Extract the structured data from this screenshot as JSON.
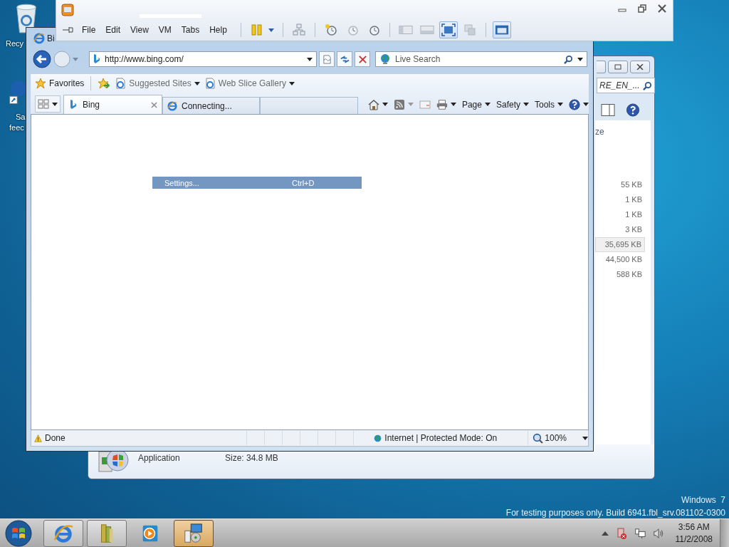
{
  "desktop": {
    "icons": [
      {
        "label": "Recy"
      },
      {
        "label": "Sa"
      },
      {
        "label": "feec"
      }
    ],
    "build_notice": [
      "Windows  7",
      "For testing purposes only. Build 6941.fbl_srv.081102-0300"
    ]
  },
  "explorer_window": {
    "search_value": "RE_EN_...",
    "column_header": "ze",
    "sizes": [
      {
        "text": "55 KB",
        "selected": false
      },
      {
        "text": "1 KB",
        "selected": false
      },
      {
        "text": "1 KB",
        "selected": false
      },
      {
        "text": "3 KB",
        "selected": false
      },
      {
        "text": "35,695 KB",
        "selected": true
      },
      {
        "text": "44,500 KB",
        "selected": false
      },
      {
        "text": "588 KB",
        "selected": false
      }
    ],
    "details": {
      "type": "Application",
      "size": "Size: 34.8 MB"
    }
  },
  "vm_window": {
    "menu": [
      "File",
      "Edit",
      "View",
      "VM",
      "Tabs",
      "Help"
    ],
    "toolbar_groups": [
      {
        "items": [
          {
            "kind": "pause",
            "selected": false,
            "menu": true
          }
        ]
      },
      {
        "items": [
          {
            "kind": "network",
            "selected": false,
            "menu": false
          }
        ]
      },
      {
        "items": [
          {
            "kind": "snapshot",
            "selected": false,
            "menu": false
          },
          {
            "kind": "revert",
            "selected": false,
            "menu": false
          },
          {
            "kind": "manage",
            "selected": false,
            "menu": false
          }
        ]
      },
      {
        "items": [
          {
            "kind": "sidebar",
            "selected": false,
            "menu": false
          },
          {
            "kind": "panel",
            "selected": false,
            "menu": false
          },
          {
            "kind": "fullscreen",
            "selected": true,
            "menu": false
          },
          {
            "kind": "unity",
            "selected": false,
            "menu": false
          }
        ]
      },
      {
        "items": [
          {
            "kind": "console",
            "selected": true,
            "menu": false
          }
        ]
      }
    ]
  },
  "ie_window": {
    "title": "Bi",
    "address": "http://www.bing.com/",
    "search_placeholder": "Live Search",
    "favorites": [
      {
        "kind": "favorites",
        "label": "Favorites"
      },
      {
        "kind": "add"
      },
      {
        "kind": "page",
        "label": "Suggested Sites",
        "menu": true
      },
      {
        "kind": "page",
        "label": "Web Slice Gallery",
        "menu": true
      }
    ],
    "tabs": [
      {
        "label": "Bing",
        "selected": true,
        "kind": "bing"
      },
      {
        "label": "Connecting...",
        "selected": false,
        "kind": "ie"
      }
    ],
    "commands": [
      {
        "kind": "home",
        "menu": true
      },
      {
        "kind": "feeds",
        "menu": true
      },
      {
        "kind": "mail",
        "menu": false
      },
      {
        "kind": "print",
        "menu": true
      },
      {
        "kind": "text",
        "label": "Page",
        "menu": true
      },
      {
        "kind": "text",
        "label": "Safety",
        "menu": true
      },
      {
        "kind": "text",
        "label": "Tools",
        "menu": true
      },
      {
        "kind": "help",
        "menu": true
      }
    ],
    "menu_item": {
      "label": "Settings...",
      "shortcut": "Ctrl+D"
    },
    "status": {
      "text": "Done",
      "zone": "Internet | Protected Mode: On",
      "zoom": "100%"
    }
  },
  "taskbar": {
    "apps": [
      {
        "kind": "ie",
        "selected": false
      },
      {
        "kind": "folder",
        "selected": false
      },
      {
        "kind": "media",
        "selected": false
      },
      {
        "kind": "installer",
        "selected": true
      }
    ],
    "time": "3:56 AM",
    "date": "11/2/2008"
  }
}
